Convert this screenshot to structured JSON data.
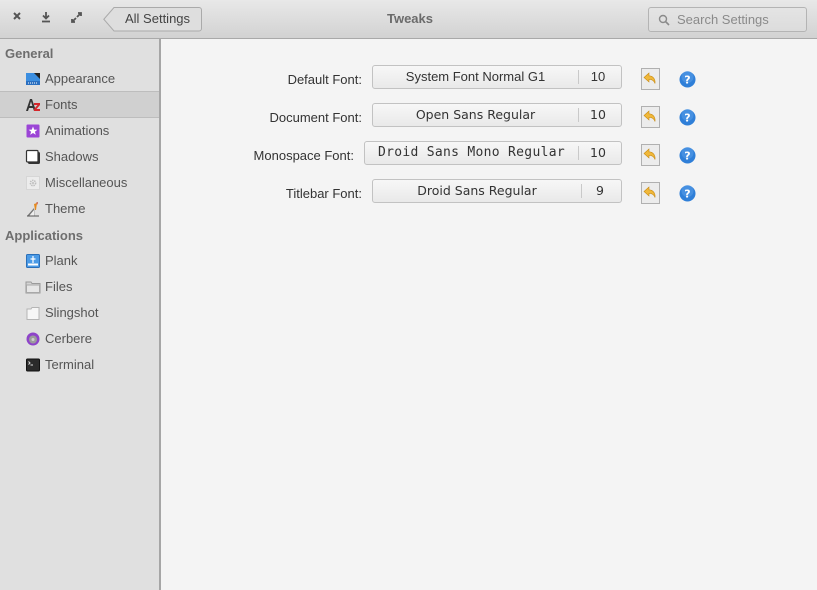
{
  "header": {
    "close_icon": "close-icon",
    "minimize_icon": "download-icon",
    "maximize_icon": "expand-icon",
    "back_label": "All Settings",
    "title": "Tweaks",
    "search_placeholder": "Search Settings",
    "search_value": ""
  },
  "sidebar": {
    "sections": [
      {
        "title": "General",
        "items": [
          {
            "label": "Appearance",
            "icon": "appearance-icon",
            "selected": false
          },
          {
            "label": "Fonts",
            "icon": "fonts-icon",
            "selected": true
          },
          {
            "label": "Animations",
            "icon": "animations-icon",
            "selected": false
          },
          {
            "label": "Shadows",
            "icon": "shadows-icon",
            "selected": false
          },
          {
            "label": "Miscellaneous",
            "icon": "miscellaneous-icon",
            "selected": false
          },
          {
            "label": "Theme",
            "icon": "theme-icon",
            "selected": false
          }
        ]
      },
      {
        "title": "Applications",
        "items": [
          {
            "label": "Plank",
            "icon": "plank-icon",
            "selected": false
          },
          {
            "label": "Files",
            "icon": "files-icon",
            "selected": false
          },
          {
            "label": "Slingshot",
            "icon": "slingshot-icon",
            "selected": false
          },
          {
            "label": "Cerbere",
            "icon": "cerbere-icon",
            "selected": false
          },
          {
            "label": "Terminal",
            "icon": "terminal-icon",
            "selected": false
          }
        ]
      }
    ]
  },
  "fonts": [
    {
      "label": "Default Font:",
      "font": "System Font Normal G1",
      "size": "10"
    },
    {
      "label": "Document Font:",
      "font": "Open Sans Regular",
      "size": "10"
    },
    {
      "label": "Monospace Font:",
      "font": "Droid Sans Mono Regular",
      "size": "10"
    },
    {
      "label": "Titlebar Font:",
      "font": "Droid Sans Regular",
      "size": "9"
    }
  ],
  "colors": {
    "help_blue": "#2f7fd8",
    "reset_yellow": "#f0b83a",
    "animations_purple": "#9b45d6",
    "appearance_blue": "#3b8ee0"
  }
}
